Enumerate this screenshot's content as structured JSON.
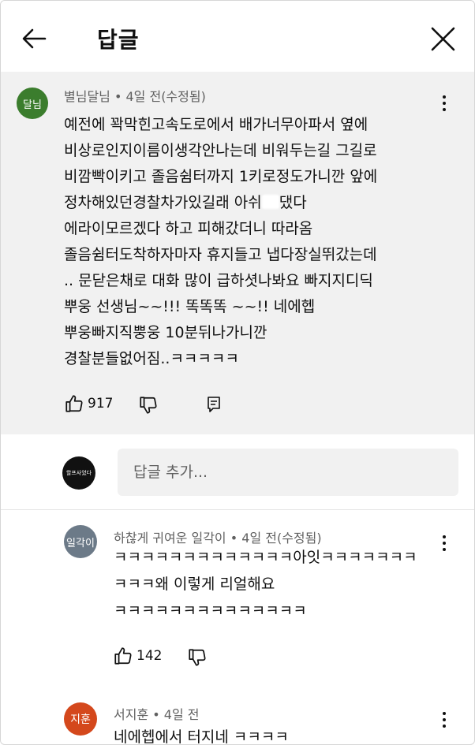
{
  "header": {
    "title": "답글"
  },
  "top_comment": {
    "avatar_text": "달님",
    "meta": "별님달님 • 4일 전(수정됨)",
    "lines": [
      "예전에 꽉막힌고속도로에서 배가너무아파서 옆에",
      "비상로인지이름이생각안나는데 비워두는길 그길로",
      "비깜빡이키고 졸음쉼터까지 1키로정도가니깐 앞에",
      "정차해있던경찰차가있길래 아쉬",
      "에라이모르겠다 하고 피해갔더니 따라옴",
      "졸음쉼터도착하자마자 휴지들고 냅다장실뛰갔는데",
      ".. 문닫은채로 대화 많이 급하셧나봐요 빠지지디딕",
      "뿌웅 선생님~~!!! 똑똑똑 ~~!! 네에헵",
      "뿌웅빠지직뿡웅 10분뒤나가니깐",
      "경찰분들없어짐..ㅋㅋㅋㅋㅋ"
    ],
    "line4_suffix": "댔다",
    "likes": "917"
  },
  "reply_box": {
    "avatar_text": "할프사었다",
    "placeholder": "답글 추가..."
  },
  "replies": [
    {
      "avatar_text": "일각이",
      "meta": "하찮게 귀여운 일각이 • 4일 전(수정됨)",
      "lines": [
        "ㅋㅋㅋㅋㅋㅋㅋㅋㅋㅋㅋㅋㅋ아잇ㅋㅋㅋㅋㅋㅋㅋ",
        "ㅋㅋㅋ왜 이렇게 리얼해요",
        "ㅋㅋㅋㅋㅋㅋㅋㅋㅋㅋㅋㅋㅋㅋ"
      ],
      "likes": "142"
    },
    {
      "avatar_text": "지훈",
      "meta": "서지훈 • 4일 전",
      "lines": [
        "네에헵에서 터지네 ㅋㅋㅋㅋ"
      ]
    }
  ],
  "colors": {
    "avatar_green": "#3b7d2d",
    "avatar_orange": "#d4481c",
    "meta_grey": "#606060"
  }
}
